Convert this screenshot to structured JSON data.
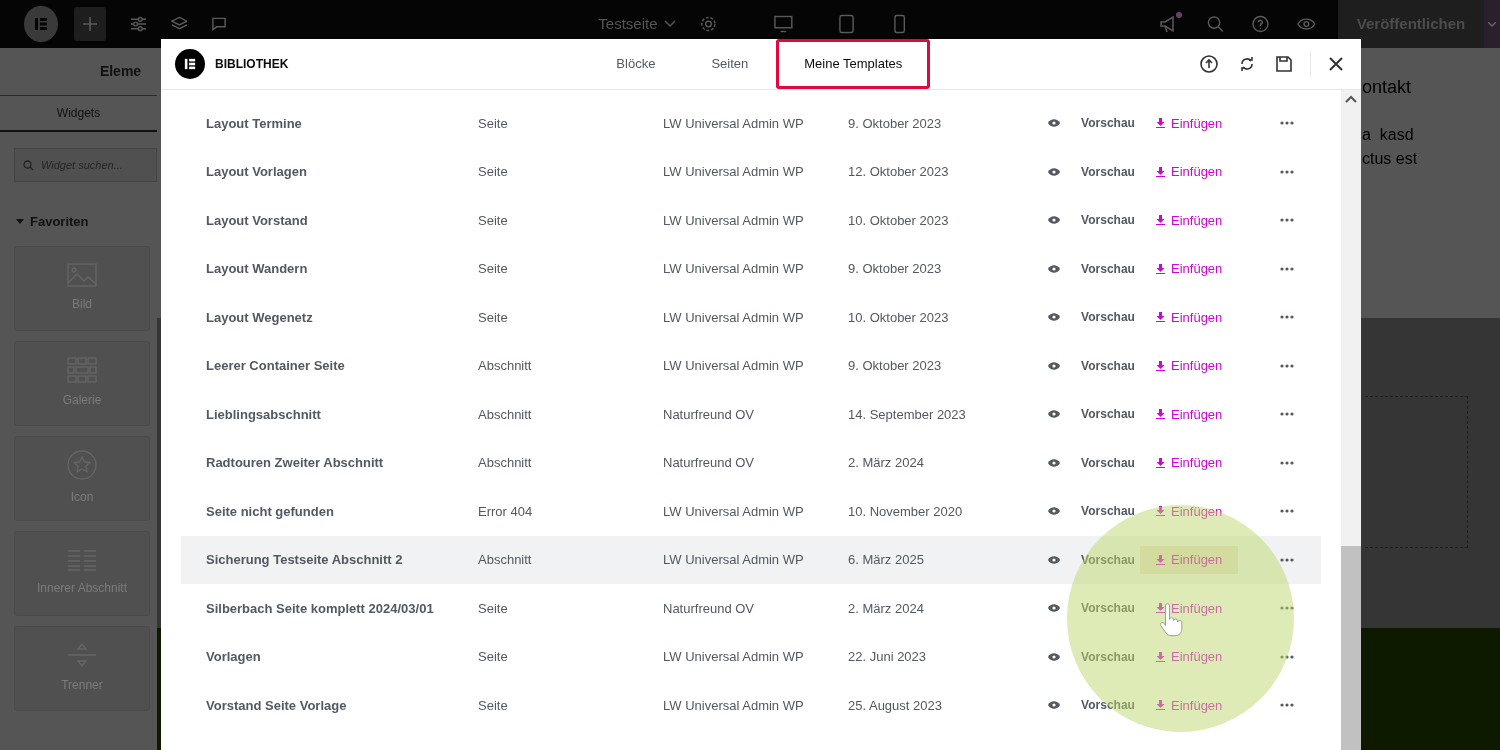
{
  "topbar": {
    "page_title": "Testseite",
    "publish_button": "Veröffentlichen",
    "notification_dot": true
  },
  "panel": {
    "title": "Eleme",
    "tab": "Widgets",
    "search": {
      "placeholder": "Widget suchen..."
    },
    "section": "Favoriten",
    "widgets": [
      {
        "kind": "image",
        "label": "Bild"
      },
      {
        "kind": "gallery",
        "label": "Galerie"
      },
      {
        "kind": "star",
        "label": "Icon"
      },
      {
        "kind": "columns",
        "label": "Innerer Abschnitt"
      },
      {
        "kind": "divider",
        "label": "Trenner"
      }
    ]
  },
  "canvas": {
    "texts": [
      "ontakt",
      "a  kasd",
      "ctus est"
    ]
  },
  "library": {
    "title": "BIBLIOTHEK",
    "tabs": [
      {
        "label": "Blöcke",
        "selected": false
      },
      {
        "label": "Seiten",
        "selected": false
      },
      {
        "label": "Meine Templates",
        "selected": true
      }
    ],
    "table": {
      "rows": [
        {
          "name": "Layout Termine",
          "type": "Seite",
          "author": "LW Universal Admin WP",
          "date": "9. Oktober 2023",
          "preview": "Vorschau",
          "insert": "Einfügen",
          "highlighted": false
        },
        {
          "name": "Layout Vorlagen",
          "type": "Seite",
          "author": "LW Universal Admin WP",
          "date": "12. Oktober 2023",
          "preview": "Vorschau",
          "insert": "Einfügen",
          "highlighted": false
        },
        {
          "name": "Layout Vorstand",
          "type": "Seite",
          "author": "LW Universal Admin WP",
          "date": "10. Oktober 2023",
          "preview": "Vorschau",
          "insert": "Einfügen",
          "highlighted": false
        },
        {
          "name": "Layout Wandern",
          "type": "Seite",
          "author": "LW Universal Admin WP",
          "date": "9. Oktober 2023",
          "preview": "Vorschau",
          "insert": "Einfügen",
          "highlighted": false
        },
        {
          "name": "Layout Wegenetz",
          "type": "Seite",
          "author": "LW Universal Admin WP",
          "date": "10. Oktober 2023",
          "preview": "Vorschau",
          "insert": "Einfügen",
          "highlighted": false
        },
        {
          "name": "Leerer Container Seite",
          "type": "Abschnitt",
          "author": "LW Universal Admin WP",
          "date": "9. Oktober 2023",
          "preview": "Vorschau",
          "insert": "Einfügen",
          "highlighted": false
        },
        {
          "name": "Lieblingsabschnitt",
          "type": "Abschnitt",
          "author": "Naturfreund OV",
          "date": "14. September 2023",
          "preview": "Vorschau",
          "insert": "Einfügen",
          "highlighted": false
        },
        {
          "name": "Radtouren Zweiter Abschnitt",
          "type": "Abschnitt",
          "author": "Naturfreund OV",
          "date": "2. März 2024",
          "preview": "Vorschau",
          "insert": "Einfügen",
          "highlighted": false
        },
        {
          "name": "Seite nicht gefunden",
          "type": "Error 404",
          "author": "LW Universal Admin WP",
          "date": "10. November 2020",
          "preview": "Vorschau",
          "insert": "Einfügen",
          "highlighted": false
        },
        {
          "name": "Sicherung Testseite Abschnitt 2",
          "type": "Abschnitt",
          "author": "LW Universal Admin WP",
          "date": "6. März 2025",
          "preview": "Vorschau",
          "insert": "Einfügen",
          "highlighted": true
        },
        {
          "name": "Silberbach Seite komplett 2024/03/01",
          "type": "Seite",
          "author": "Naturfreund OV",
          "date": "2. März 2024",
          "preview": "Vorschau",
          "insert": "Einfügen",
          "highlighted": false
        },
        {
          "name": "Vorlagen",
          "type": "Seite",
          "author": "LW Universal Admin WP",
          "date": "22. Juni 2023",
          "preview": "Vorschau",
          "insert": "Einfügen",
          "highlighted": false
        },
        {
          "name": "Vorstand Seite Vorlage",
          "type": "Seite",
          "author": "LW Universal Admin WP",
          "date": "25. August 2023",
          "preview": "Vorschau",
          "insert": "Einfügen",
          "highlighted": false
        }
      ]
    }
  }
}
